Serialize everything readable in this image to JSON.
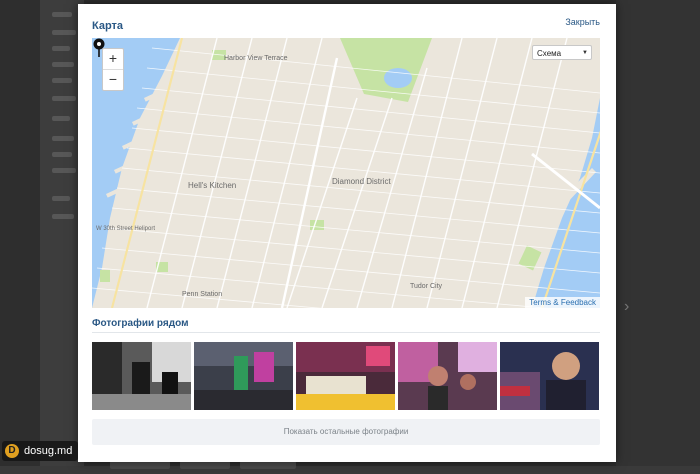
{
  "modal": {
    "title": "Карта",
    "close_label": "Закрыть"
  },
  "map": {
    "zoom_in_label": "+",
    "zoom_out_label": "−",
    "map_type_value": "Схема",
    "terms_label": "Terms & Feedback",
    "labels": {
      "harbor_view": "Harbor View Terrace",
      "hells_kitchen": "Hell's Kitchen",
      "diamond_district": "Diamond District",
      "penn_station": "Penn Station",
      "tudor_city": "Tudor City",
      "w30": "W 30th Street Heliport"
    },
    "colors": {
      "land": "#ebe6dc",
      "water": "#a3ccf5",
      "park": "#c6e3a4",
      "road": "#ffffff"
    }
  },
  "photos": {
    "title": "Фотографии рядом",
    "items": [
      "photo-1",
      "photo-2",
      "photo-3",
      "photo-4",
      "photo-5"
    ],
    "show_more_label": "Показать остальные фотографии"
  },
  "watermark": {
    "text": "dosug.md",
    "logo_letter": "D"
  }
}
